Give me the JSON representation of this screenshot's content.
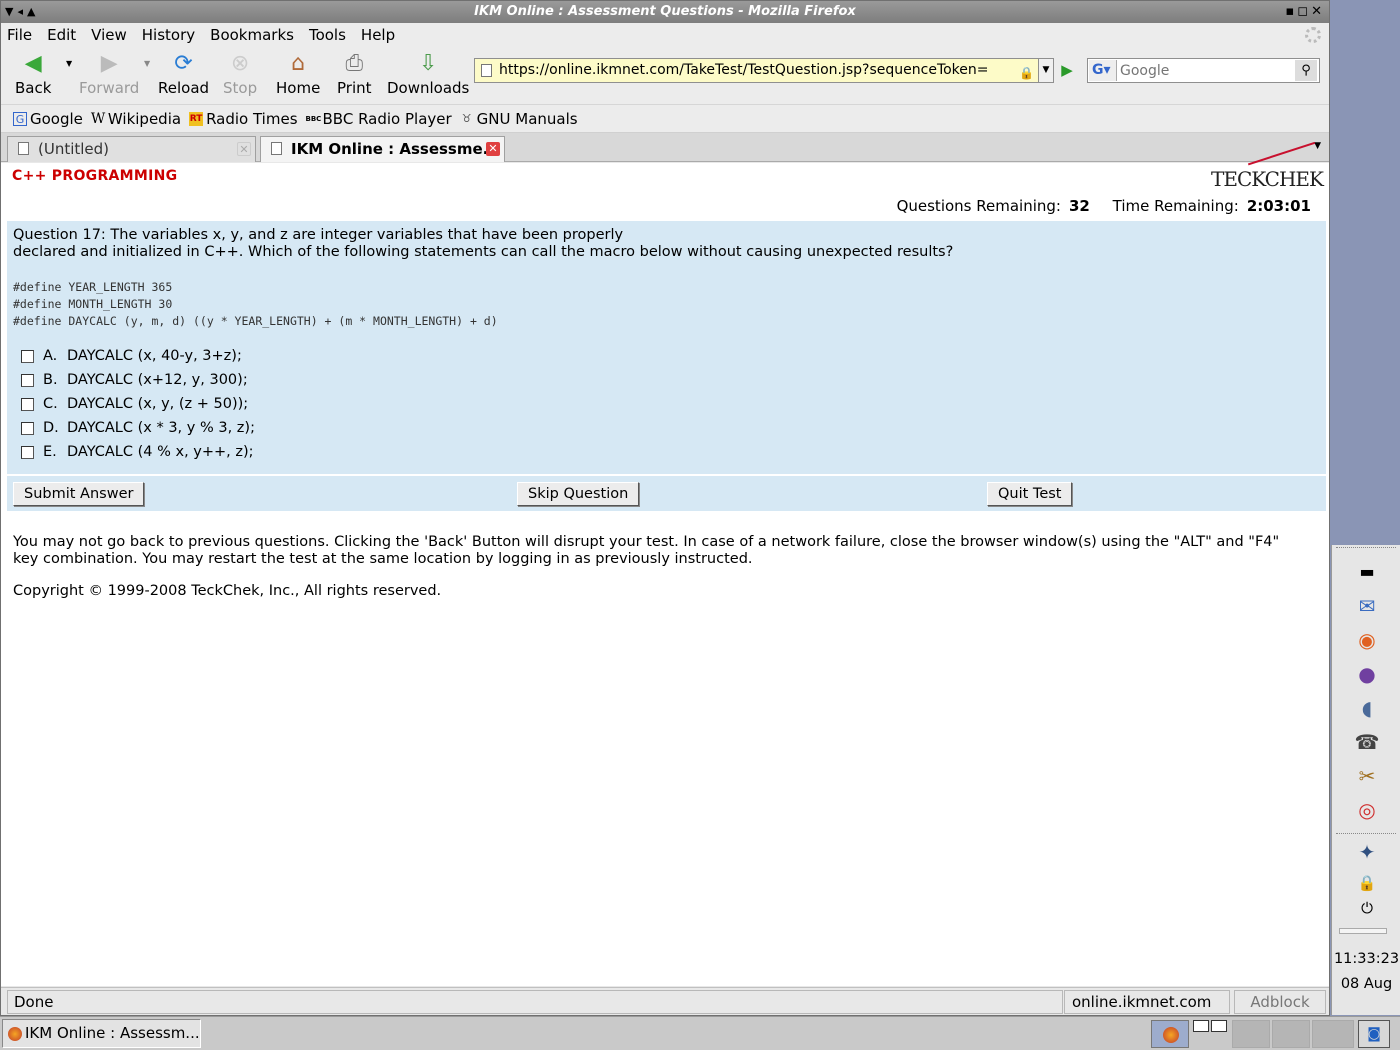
{
  "window": {
    "title": "IKM Online : Assessment Questions - Mozilla Firefox"
  },
  "menu": [
    "File",
    "Edit",
    "View",
    "History",
    "Bookmarks",
    "Tools",
    "Help"
  ],
  "toolbar": {
    "back": "Back",
    "forward": "Forward",
    "reload": "Reload",
    "stop": "Stop",
    "home": "Home",
    "print": "Print",
    "downloads": "Downloads",
    "url": "https://online.ikmnet.com/TakeTest/TestQuestion.jsp?sequenceToken=",
    "search_placeholder": "Google"
  },
  "bookmarks": [
    {
      "label": "Google",
      "icon": "google-icon"
    },
    {
      "label": "Wikipedia",
      "icon": "wikipedia-icon"
    },
    {
      "label": "Radio Times",
      "icon": "radiotimes-icon"
    },
    {
      "label": "BBC Radio Player",
      "icon": "bbc-icon"
    },
    {
      "label": "GNU Manuals",
      "icon": "gnu-icon"
    }
  ],
  "tabs": [
    {
      "label": "(Untitled)",
      "active": false
    },
    {
      "label": "IKM Online : Assessme...",
      "active": true
    }
  ],
  "page": {
    "subject": "C++ PROGRAMMING",
    "logo": "TECKCHEK",
    "questions_remaining_label": "Questions Remaining:",
    "questions_remaining": "32",
    "time_remaining_label": "Time Remaining:",
    "time_remaining": "2:03:01",
    "question_line1": "Question 17: The variables x, y, and z are integer variables that have been properly",
    "question_line2": "declared and initialized in C++. Which of the following statements can call the macro below without causing unexpected results?",
    "code": [
      "#define YEAR_LENGTH 365",
      "#define MONTH_LENGTH 30",
      "#define DAYCALC (y, m, d) ((y * YEAR_LENGTH) + (m * MONTH_LENGTH) + d)"
    ],
    "options": [
      {
        "letter": "A.",
        "text": "DAYCALC (x, 40-y, 3+z);",
        "checked": false
      },
      {
        "letter": "B.",
        "text": "DAYCALC (x+12, y, 300);",
        "checked": false
      },
      {
        "letter": "C.",
        "text": "DAYCALC (x, y, (z + 50));",
        "checked": false
      },
      {
        "letter": "D.",
        "text": "DAYCALC (x * 3, y % 3, z);",
        "checked": false
      },
      {
        "letter": "E.",
        "text": "DAYCALC (4 % x, y++, z);",
        "checked": false
      }
    ],
    "submit": "Submit Answer",
    "skip": "Skip Question",
    "quit": "Quit Test",
    "note": "You may not go back to previous questions. Clicking the 'Back' Button will disrupt your test. In case of a network failure, close the browser window(s) using the \"ALT\" and \"F4\" key combination. You may restart the test at the same location by logging in as previously instructed.",
    "copyright": "Copyright © 1999-2008 TeckChek, Inc., All rights reserved."
  },
  "status": {
    "text": "Done",
    "host": "online.ikmnet.com",
    "adblock": "Adblock"
  },
  "taskbar": {
    "item": "IKM Online : Assessm..."
  },
  "dock": {
    "clock": "11:33:23",
    "date": "08 Aug"
  }
}
